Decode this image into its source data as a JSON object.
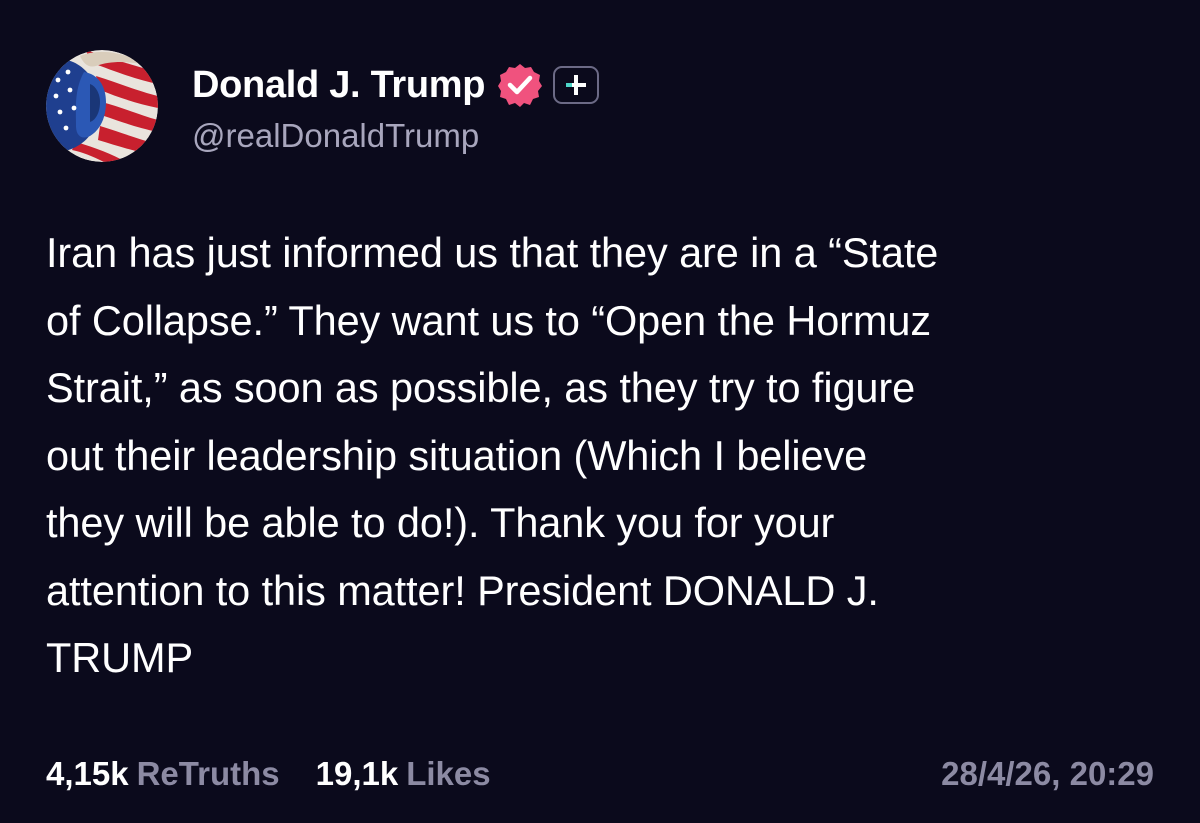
{
  "post": {
    "author": {
      "display_name": "Donald J. Trump",
      "handle": "@realDonaldTrump",
      "avatar": "flag-face-avatar",
      "verified_icon": "verified-badge-icon",
      "plus_icon": "plus-badge-icon"
    },
    "text": "Iran has just informed us that they are in a “State\nof Collapse.” They want us to “Open the Hormuz\nStrait,” as soon as possible, as they try to figure\nout their leadership situation (Which I believe\nthey will be able to do!). Thank you for your\nattention to this matter! President DONALD J.\nTRUMP",
    "stats": {
      "retruths_count": "4,15k",
      "retruths_label": "ReTruths",
      "likes_count": "19,1k",
      "likes_label": "Likes"
    },
    "timestamp": "28/4/26, 20:29"
  },
  "colors": {
    "background": "#0b0a1c",
    "text_primary": "#ffffff",
    "text_secondary": "#a8a6bd",
    "verified_badge": "#f0527e",
    "plus_accent": "#4ed6c9"
  }
}
